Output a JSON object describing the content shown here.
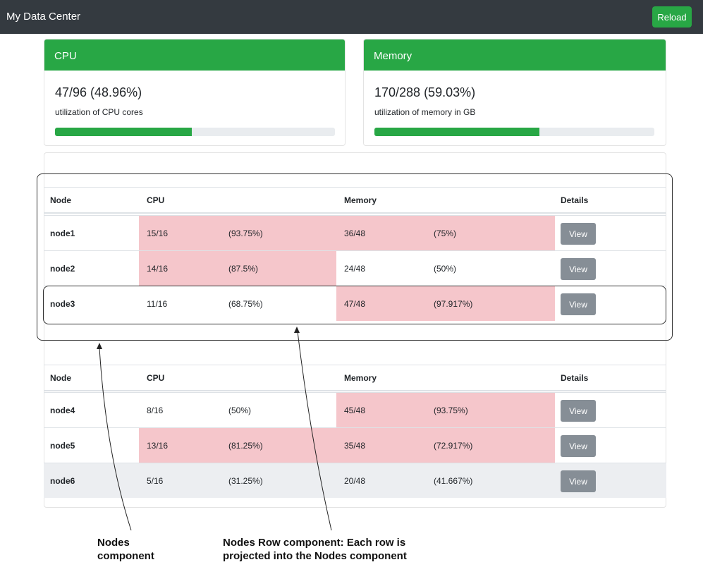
{
  "navbar": {
    "brand": "My Data Center",
    "reload_label": "Reload"
  },
  "cards": {
    "cpu": {
      "title": "CPU",
      "value": "47/96 (48.96%)",
      "subtitle": "utilization of CPU cores",
      "progress_fraction": 0.4896
    },
    "memory": {
      "title": "Memory",
      "value": "170/288 (59.03%)",
      "subtitle": "utilization of memory in GB",
      "progress_fraction": 0.5903
    }
  },
  "tables": [
    {
      "headers": {
        "node": "Node",
        "cpu": "CPU",
        "memory": "Memory",
        "details": "Details"
      },
      "rows": [
        {
          "node": "node1",
          "cpu": "15/16",
          "cpu_pct": "(93.75%)",
          "mem": "36/48",
          "mem_pct": "(75%)",
          "button": "View",
          "cpu_high": true,
          "mem_high": true
        },
        {
          "node": "node2",
          "cpu": "14/16",
          "cpu_pct": "(87.5%)",
          "mem": "24/48",
          "mem_pct": "(50%)",
          "button": "View",
          "cpu_high": true,
          "mem_high": false
        },
        {
          "node": "node3",
          "cpu": "11/16",
          "cpu_pct": "(68.75%)",
          "mem": "47/48",
          "mem_pct": "(97.917%)",
          "button": "View",
          "cpu_high": false,
          "mem_high": true
        }
      ]
    },
    {
      "headers": {
        "node": "Node",
        "cpu": "CPU",
        "memory": "Memory",
        "details": "Details"
      },
      "rows": [
        {
          "node": "node4",
          "cpu": "8/16",
          "cpu_pct": "(50%)",
          "mem": "45/48",
          "mem_pct": "(93.75%)",
          "button": "View",
          "cpu_high": false,
          "mem_high": true
        },
        {
          "node": "node5",
          "cpu": "13/16",
          "cpu_pct": "(81.25%)",
          "mem": "35/48",
          "mem_pct": "(72.917%)",
          "button": "View",
          "cpu_high": true,
          "mem_high": true
        },
        {
          "node": "node6",
          "cpu": "5/16",
          "cpu_pct": "(31.25%)",
          "mem": "20/48",
          "mem_pct": "(41.667%)",
          "button": "View",
          "cpu_high": false,
          "mem_high": false,
          "shaded": true
        }
      ]
    }
  ],
  "annotations": {
    "nodes_component": {
      "line1": "Nodes",
      "line2": "component"
    },
    "nodes_row_component": {
      "line1": "Nodes Row component: Each row is",
      "line2": "projected into the Nodes component"
    }
  },
  "colors": {
    "accent": "#28a745",
    "navbar": "#343a40",
    "highlight": "#f5c6cb",
    "button": "#868e96"
  }
}
